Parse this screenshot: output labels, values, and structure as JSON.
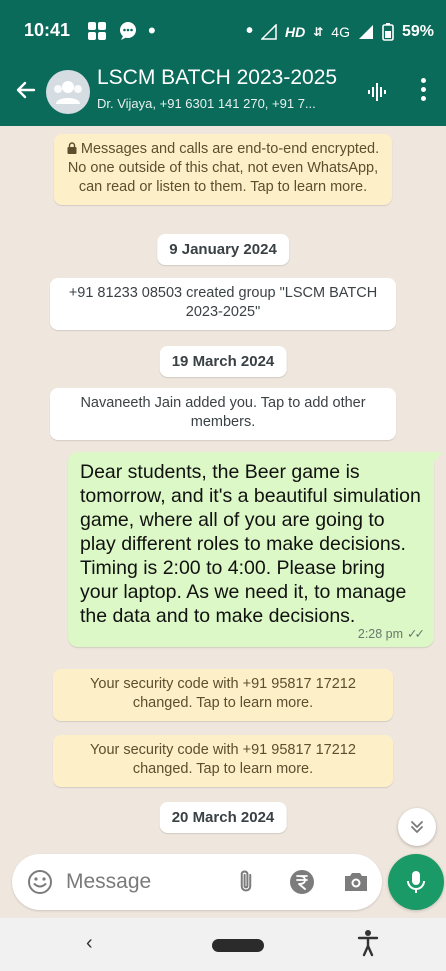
{
  "status_bar": {
    "time": "10:41",
    "network": "HD",
    "signal_type": "4G",
    "battery": "59%"
  },
  "header": {
    "back_icon": "arrow-left-icon",
    "title": "LSCM BATCH 2023-2025",
    "subtitle": "Dr. Vijaya, +91 6301 141 270, +91 7...",
    "voice_icon": "audio-waveform-icon",
    "menu_icon": "more-vertical-icon",
    "bar_color": "#0b6b5a"
  },
  "chat": {
    "encryption_notice": "Messages and calls are end-to-end encrypted. No one outside of this chat, not even WhatsApp, can read or listen to them. Tap to learn more.",
    "date_1": "9 January 2024",
    "created_notice": "+91 81233 08503 created group \"LSCM BATCH 2023-2025\"",
    "date_2": "19 March 2024",
    "added_notice": "Navaneeth Jain added you. Tap to add other members.",
    "message": {
      "text": "Dear students, the Beer game is tomorrow, and it's a beautiful simulation game, where all of you are going to play different roles to make decisions. Timing is 2:00 to 4:00. Please bring your laptop. As we need it, to manage the data and to make decisions.",
      "time": "2:28 pm",
      "status": "read",
      "bubble_color": "#dcf8c6"
    },
    "security_notice_1": "Your security code with +91 95817 17212 changed. Tap to learn more.",
    "security_notice_2": "Your security code with +91 95817 17212 changed. Tap to learn more.",
    "date_3": "20 March 2024"
  },
  "composer": {
    "placeholder": "Message",
    "icons": [
      "emoji-icon",
      "attach-icon",
      "rupee-icon",
      "camera-icon",
      "mic-icon"
    ],
    "mic_color": "#1a9a66"
  },
  "nav_bar": {
    "icons": [
      "back-chevron-icon",
      "home-pill-icon",
      "accessibility-icon"
    ]
  }
}
